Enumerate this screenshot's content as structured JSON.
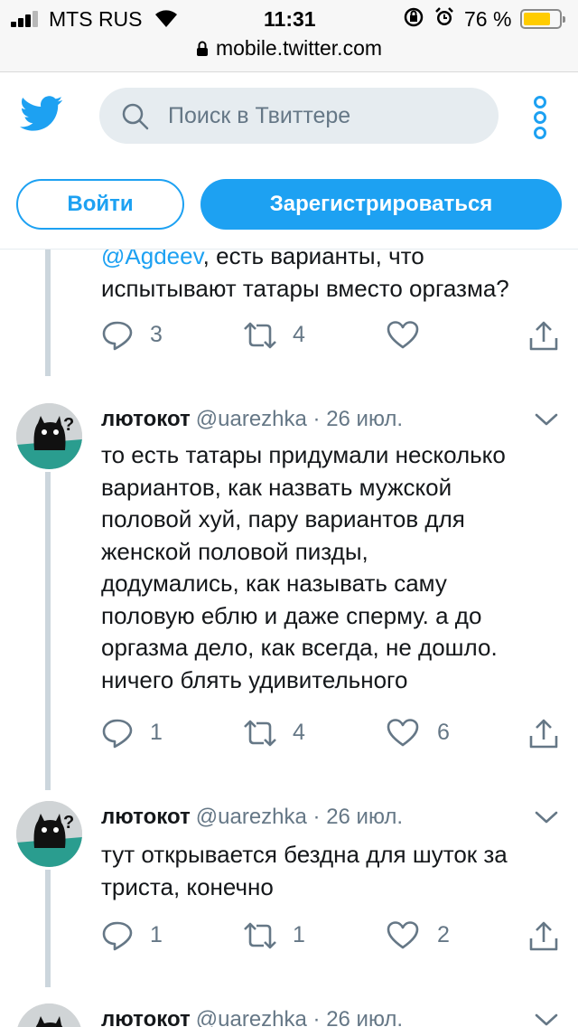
{
  "status_bar": {
    "carrier": "MTS RUS",
    "time": "11:31",
    "battery_percent": "76 %",
    "battery_level": 0.76,
    "icons": [
      "signal-icon",
      "wifi-icon",
      "orientation-lock-icon",
      "alarm-icon",
      "battery-icon"
    ]
  },
  "browser": {
    "url": "mobile.twitter.com"
  },
  "header": {
    "logo_icon": "twitter-bird-icon",
    "search_placeholder": "Поиск в Твиттере",
    "more_icon": "more-vertical-icon",
    "login_label": "Войти",
    "signup_label": "Зарегистрироваться",
    "accent_color": "#1da1f2"
  },
  "tweets": [
    {
      "mention": "@Agdeev",
      "text_line1_rest": ", есть варианты, что",
      "text_line2": "испытывают татары вместо оргазма?",
      "replies": "3",
      "retweets": "4",
      "likes": ""
    },
    {
      "name": "лютокот",
      "handle": "@uarezhka · 26 июл.",
      "lines": [
        "то есть татары придумали несколько",
        "вариантов, как назвать мужской",
        "половой хуй, пару вариантов для",
        "женской половой пизды,",
        "додумались, как называть саму",
        "половую еблю и даже сперму. а до",
        "оргазма дело, как всегда, не дошло.",
        "ничего блять удивительного"
      ],
      "replies": "1",
      "retweets": "4",
      "likes": "6"
    },
    {
      "name": "лютокот",
      "handle": "@uarezhka · 26 июл.",
      "lines": [
        "тут открывается бездна для шуток за",
        "триста, конечно"
      ],
      "replies": "1",
      "retweets": "1",
      "likes": "2"
    },
    {
      "name": "лютокот",
      "handle": "@uarezhka · 26 июл."
    }
  ]
}
